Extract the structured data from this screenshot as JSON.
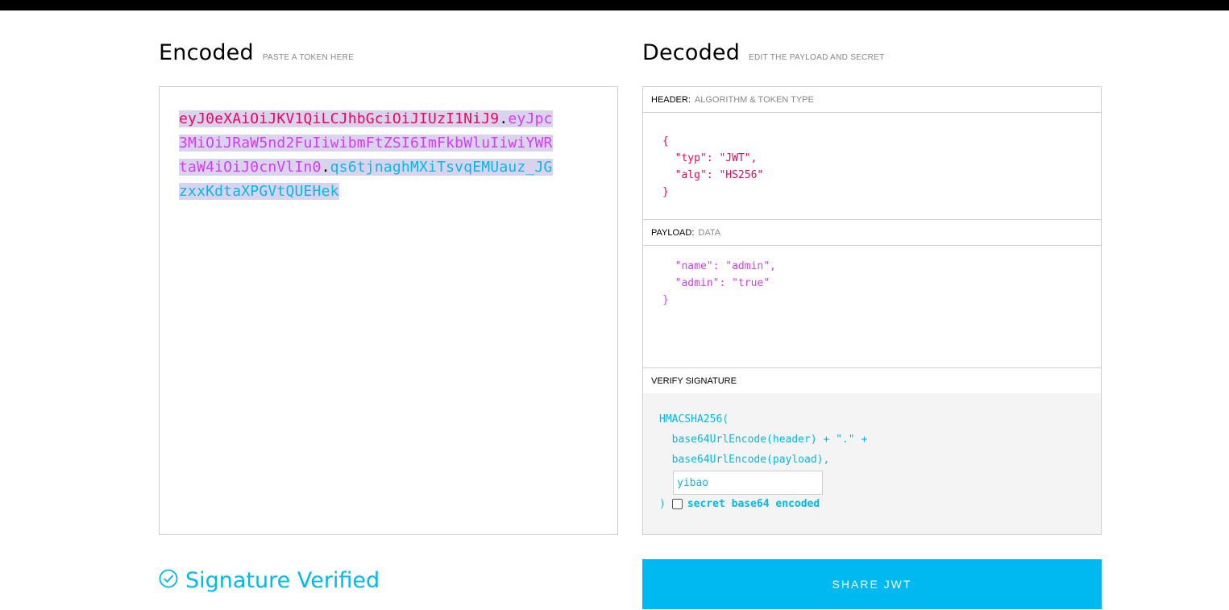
{
  "encoded": {
    "title": "Encoded",
    "subtitle": "PASTE A TOKEN HERE",
    "token": {
      "header": "eyJ0eXAiOiJKV1QiLCJhbGciOiJIUzI1NiJ9",
      "payload": "eyJpc3MiOiJRaW5nd2FuIiwibmFtZSI6ImFkbWluIiwiYWRtaW4iOiJ0cnVlIn0",
      "signature": "qs6tjnaghMXiTsvqEMUauz_JGzxxKdtaXPGVtQUEHek",
      "dot": "."
    }
  },
  "decoded": {
    "title": "Decoded",
    "subtitle": "EDIT THE PAYLOAD AND SECRET",
    "header_section": {
      "label": "HEADER:",
      "sublabel": "ALGORITHM & TOKEN TYPE",
      "json_text": "{\n  \"typ\": \"JWT\",\n  \"alg\": \"HS256\"\n}"
    },
    "payload_section": {
      "label": "PAYLOAD:",
      "sublabel": "DATA",
      "json_text": "  \"name\": \"admin\",\n  \"admin\": \"true\"\n}"
    },
    "verify_section": {
      "label": "VERIFY SIGNATURE",
      "line1": "HMACSHA256(",
      "line2": "  base64UrlEncode(header) + \".\" +",
      "line3": "  base64UrlEncode(payload),",
      "secret_value": "yibao",
      "close_paren": ")",
      "checkbox_label": "secret base64 encoded",
      "checkbox_checked": false
    }
  },
  "status": {
    "text": "Signature Verified",
    "icon": "check-circle-icon",
    "color": "#00b9f1"
  },
  "share_button": {
    "label": "SHARE JWT"
  }
}
